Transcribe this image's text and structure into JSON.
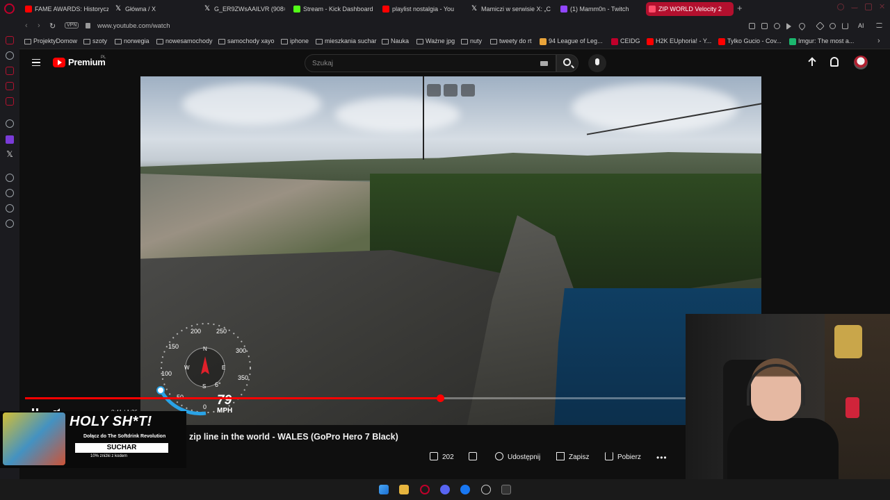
{
  "browser": {
    "tabs": [
      {
        "label": "FAME AWARDS: Historycz",
        "icon": "youtube-icon",
        "color": "#ff0000",
        "active": false
      },
      {
        "label": "Główna / X",
        "icon": "x-icon",
        "color": "#ffffff",
        "active": false
      },
      {
        "label": "G_ER9ZWsAAILVR (908×",
        "icon": "x-icon",
        "color": "#ffffff",
        "active": false
      },
      {
        "label": "Stream - Kick Dashboard",
        "icon": "kick-icon",
        "color": "#53fc18",
        "active": false
      },
      {
        "label": "playlist nostalgia - You",
        "icon": "youtube-icon",
        "color": "#ff0000",
        "active": false
      },
      {
        "label": "Mamiczi w serwisie X: „C",
        "icon": "x-icon",
        "color": "#ffffff",
        "active": false
      },
      {
        "label": "(1) Mamm0n - Twitch",
        "icon": "twitch-icon",
        "color": "#9146ff",
        "active": false
      },
      {
        "label": "ZIP WORLD Velocity 2",
        "icon": "youtube-icon",
        "color": "#ff0000",
        "active": true
      }
    ],
    "new_tab": "+",
    "vpn_label": "VPN",
    "url": "www.youtube.com/watch",
    "ai_label": "AI",
    "bookmarks": [
      {
        "label": "ProjektyDomow",
        "type": "folder"
      },
      {
        "label": "szoty",
        "type": "folder"
      },
      {
        "label": "norwegia",
        "type": "folder"
      },
      {
        "label": "nowesamochody",
        "type": "folder"
      },
      {
        "label": "samochody xayo",
        "type": "folder"
      },
      {
        "label": "iphone",
        "type": "folder"
      },
      {
        "label": "mieszkania suchar",
        "type": "folder"
      },
      {
        "label": "Nauka",
        "type": "folder"
      },
      {
        "label": "Ważne jpg",
        "type": "folder"
      },
      {
        "label": "nuty",
        "type": "folder"
      },
      {
        "label": "tweety do rt",
        "type": "folder"
      },
      {
        "label": "94 League of Leg...",
        "type": "site",
        "color": "#e8a33a"
      },
      {
        "label": "CEIDG",
        "type": "site",
        "color": "#c0002b"
      },
      {
        "label": "H2K EUphoria! - Y...",
        "type": "site",
        "color": "#ff0000"
      },
      {
        "label": "Tylko Gucio - Cov...",
        "type": "site",
        "color": "#ff0000"
      },
      {
        "label": "Imgur: The most a...",
        "type": "site",
        "color": "#1bb76e"
      }
    ]
  },
  "youtube": {
    "brand": "Premium",
    "region": "PL",
    "search_placeholder": "Szukaj",
    "video_title": "zip line in the world - WALES (GoPro Hero 7 Black)",
    "timecode": "8:41 / 1:26",
    "progress_fraction": 0.628,
    "actions": {
      "likes": "202",
      "share": "Udostępnij",
      "save": "Zapisz",
      "download": "Pobierz"
    }
  },
  "gauge": {
    "speed_ticks": [
      "0",
      "50",
      "100",
      "150",
      "200",
      "250",
      "300",
      "350"
    ],
    "compass": {
      "n": "N",
      "e": "E",
      "s": "S",
      "w": "W"
    },
    "heading": "6°",
    "speed": "79",
    "unit": "MPH"
  },
  "ad": {
    "headline": "HOLY SH*T!",
    "subline": "Dołącz do The Softdrink Revolution",
    "brand": "SUCHAR",
    "note": "10% zniżki z kodem"
  }
}
